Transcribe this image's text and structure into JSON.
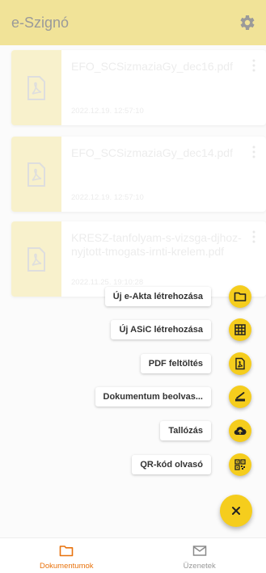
{
  "app": {
    "title": "e-Szignó"
  },
  "documents": [
    {
      "name": "EFO_SCSizmaziaGy_dec16.pdf",
      "date": "2022.12.19. 12:57:10"
    },
    {
      "name": "EFO_SCSizmaziaGy_dec14.pdf",
      "date": "2022.12.19. 12:57:10"
    },
    {
      "name": "KRESZ-tanfolyam-s-vizsga-djhoz-nyjtott-tmogats-irnti-krelem.pdf",
      "date": "2022.11.25. 19:10:28"
    }
  ],
  "speed_dial": [
    {
      "label": "Új e-Akta létrehozása",
      "icon": "folder-icon"
    },
    {
      "label": "Új ASiC létrehozása",
      "icon": "grid-icon"
    },
    {
      "label": "PDF feltöltés",
      "icon": "pdf-icon"
    },
    {
      "label": "Dokumentum beolvas...",
      "icon": "scanner-icon"
    },
    {
      "label": "Tallózás",
      "icon": "cloud-upload-icon"
    },
    {
      "label": "QR-kód olvasó",
      "icon": "qr-code-icon"
    }
  ],
  "main_fab": {
    "icon": "close-icon"
  },
  "bottom_nav": [
    {
      "label": "Dokumentumok",
      "icon": "folder-icon",
      "active": true
    },
    {
      "label": "Üzenetek",
      "icon": "mail-icon",
      "active": false
    }
  ],
  "colors": {
    "primary": "#f5cd1d",
    "primary_light": "#f1e398",
    "accent_active": "#e8720c"
  }
}
